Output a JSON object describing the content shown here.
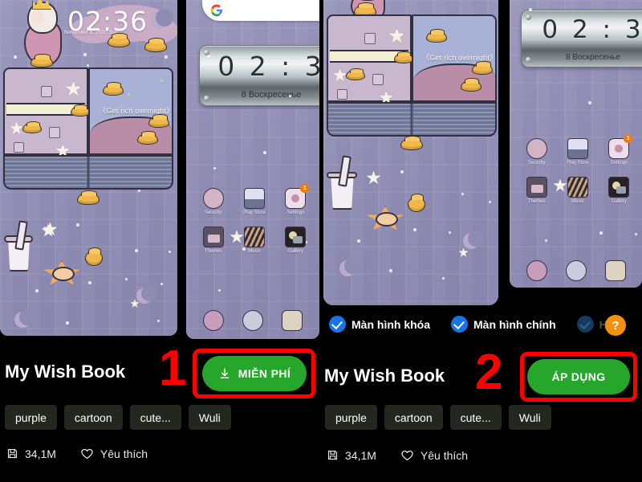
{
  "screen": {
    "background": "#000000",
    "accent_green": "#27a62c",
    "accent_blue": "#1a73e8",
    "accent_orange": "#f3900c",
    "annotation_red": "#fd0000"
  },
  "steps": [
    {
      "number": "1"
    },
    {
      "number": "2"
    }
  ],
  "left_screen": {
    "name": "theme-detail-download",
    "previews": [
      {
        "id": "lockscreen-preview",
        "type": "lockscreen",
        "clock": "02:36",
        "date": "November 8, 2020   Sun",
        "book_quote": "《Get rich overnight》",
        "apps": []
      },
      {
        "id": "homescreen-preview",
        "type": "homescreen",
        "search_placeholder": "",
        "clock": "0 2 : 3",
        "date": "8  Воскресенье",
        "apps": [
          {
            "label": "Security",
            "icon": "saturn-icon",
            "badge": ""
          },
          {
            "label": "Play Store",
            "icon": "bag-icon",
            "badge": ""
          },
          {
            "label": "Settings",
            "icon": "camera-gear-icon",
            "badge": "1"
          },
          {
            "label": "Themes",
            "icon": "themes-icon",
            "badge": ""
          },
          {
            "label": "Music",
            "icon": "music-icon",
            "badge": ""
          },
          {
            "label": "Gallery",
            "icon": "gallery-icon",
            "badge": ""
          }
        ],
        "dock": [
          "phone-icon",
          "browser-icon",
          "messages-icon"
        ]
      }
    ],
    "title": "My Wish Book",
    "action_button": {
      "label": "MIỄN PHÍ",
      "icon": "download-icon"
    },
    "tags": [
      "purple",
      "cartoon",
      "cute...",
      "Wuli"
    ],
    "size": {
      "icon": "save-icon",
      "value": "34,1M"
    },
    "favorite": {
      "icon": "heart-icon",
      "label": "Yêu thích"
    }
  },
  "right_screen": {
    "name": "theme-detail-apply",
    "previews": [
      {
        "id": "lockscreen-preview",
        "type": "lockscreen-book",
        "book_quote": "《Get rich overnight》",
        "apps": []
      },
      {
        "id": "homescreen-preview",
        "type": "homescreen",
        "clock": "0 2 : 3",
        "date": "8  Воскресенье",
        "apps": [
          {
            "label": "Security",
            "icon": "saturn-icon",
            "badge": ""
          },
          {
            "label": "Play Store",
            "icon": "bag-icon",
            "badge": ""
          },
          {
            "label": "Settings",
            "icon": "camera-gear-icon",
            "badge": "1"
          },
          {
            "label": "Themes",
            "icon": "themes-icon",
            "badge": ""
          },
          {
            "label": "Music",
            "icon": "music-icon",
            "badge": ""
          },
          {
            "label": "Gallery",
            "icon": "gallery-icon",
            "badge": ""
          }
        ],
        "dock": [
          "phone-icon",
          "browser-icon",
          "messages-icon"
        ]
      }
    ],
    "checkboxes": [
      {
        "label": "Màn hình khóa",
        "checked": true,
        "disabled": false
      },
      {
        "label": "Màn hình chính",
        "checked": true,
        "disabled": false
      },
      {
        "label": "H",
        "checked": true,
        "disabled": true
      }
    ],
    "help_button": {
      "label": "?"
    },
    "title": "My Wish Book",
    "action_button": {
      "label": "ÁP DỤNG",
      "icon": ""
    },
    "tags": [
      "purple",
      "cartoon",
      "cute...",
      "Wuli"
    ],
    "size": {
      "icon": "save-icon",
      "value": "34,1M"
    },
    "favorite": {
      "icon": "heart-icon",
      "label": "Yêu thích"
    }
  }
}
